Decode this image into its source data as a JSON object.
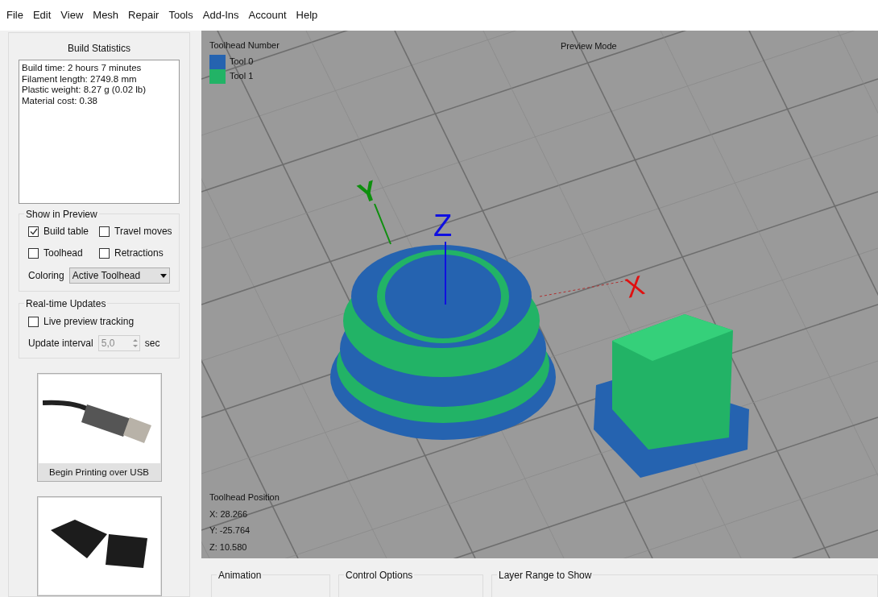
{
  "menu": [
    "File",
    "Edit",
    "View",
    "Mesh",
    "Repair",
    "Tools",
    "Add-Ins",
    "Account",
    "Help"
  ],
  "build_statistics": {
    "title": "Build Statistics",
    "lines": [
      "Build time: 2 hours 7 minutes",
      "Filament length: 2749.8 mm",
      "Plastic weight: 8.27 g (0.02 lb)",
      "Material cost: 0.38"
    ]
  },
  "show_in_preview": {
    "title": "Show in Preview",
    "options": [
      {
        "label": "Build table",
        "checked": true
      },
      {
        "label": "Travel moves",
        "checked": false
      },
      {
        "label": "Toolhead",
        "checked": false
      },
      {
        "label": "Retractions",
        "checked": false
      }
    ],
    "coloring": {
      "label": "Coloring",
      "value": "Active Toolhead"
    }
  },
  "realtime_updates": {
    "title": "Real-time Updates",
    "live_preview": {
      "label": "Live preview tracking",
      "checked": false
    },
    "interval": {
      "label": "Update interval",
      "value": "5,0",
      "unit": "sec",
      "disabled": true
    }
  },
  "print_buttons": [
    {
      "label": "Begin Printing over USB"
    }
  ],
  "viewport": {
    "legend_title": "Toolhead Number",
    "tools": [
      {
        "label": "Tool 0",
        "color": "#2563b0"
      },
      {
        "label": "Tool 1",
        "color": "#22b366"
      }
    ],
    "mode": "Preview Mode",
    "axes": [
      {
        "label": "Y",
        "color": "#0e8f0e"
      },
      {
        "label": "Z",
        "color": "#1010e0"
      },
      {
        "label": "X",
        "color": "#e01010"
      }
    ],
    "position": {
      "title": "Toolhead Position",
      "lines": [
        "X: 28.266",
        "Y: -25.764",
        "Z: 10.580"
      ]
    }
  },
  "bottom_groups": [
    "Animation",
    "Control Options",
    "Layer Range to Show"
  ]
}
